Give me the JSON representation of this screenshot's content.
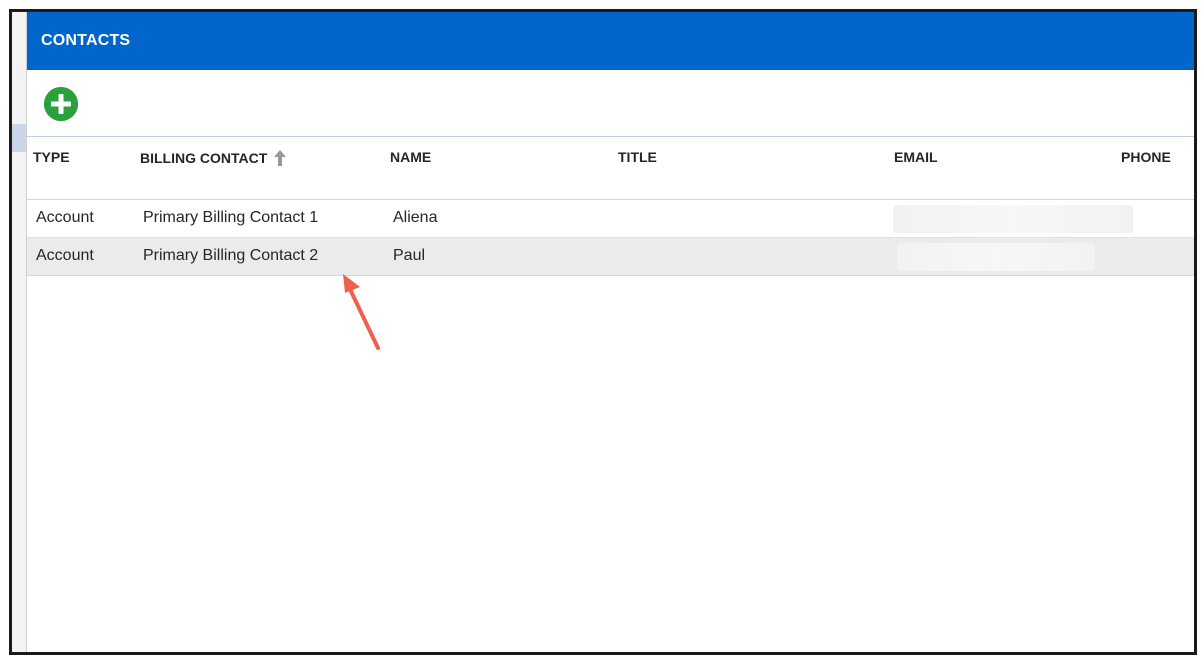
{
  "dialog": {
    "title": "CONTACTS"
  },
  "toolbar": {
    "add_icon": "plus-circle-icon"
  },
  "table": {
    "columns": {
      "type": "TYPE",
      "billing_contact": "BILLING CONTACT",
      "name": "NAME",
      "title": "TITLE",
      "email": "EMAIL",
      "phone": "PHONE"
    },
    "sort_icon": "sort-ascending-icon",
    "rows": [
      {
        "type": "Account",
        "billing_contact": "Primary Billing Contact 1",
        "name": "Aliena",
        "title": "",
        "phone": ""
      },
      {
        "type": "Account",
        "billing_contact": "Primary Billing Contact 2",
        "name": "Paul",
        "title": "",
        "phone": ""
      }
    ]
  },
  "colors": {
    "header": "#0066cc",
    "add_button": "#2aa13c",
    "annotation_arrow": "#f0604f",
    "row_highlight": "#ebebeb"
  }
}
